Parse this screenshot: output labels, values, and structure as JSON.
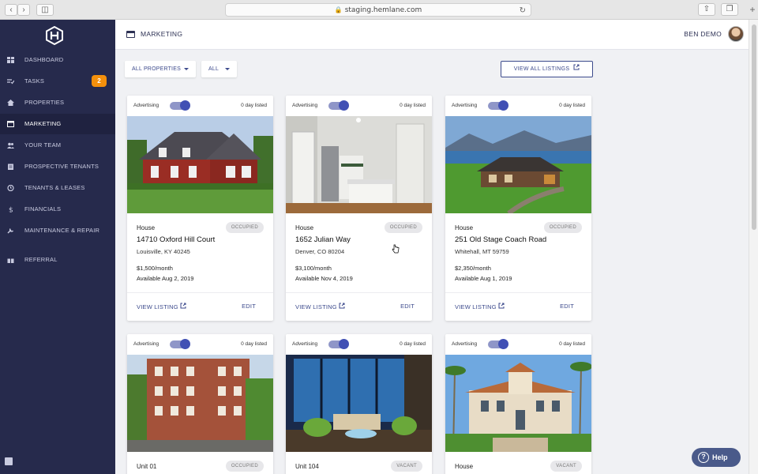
{
  "browser": {
    "url": "staging.hemlane.com"
  },
  "sidebar": {
    "items": [
      {
        "label": "DASHBOARD",
        "icon": "dashboard-icon"
      },
      {
        "label": "TASKS",
        "icon": "tasks-icon",
        "badge": "2"
      },
      {
        "label": "PROPERTIES",
        "icon": "home-icon"
      },
      {
        "label": "MARKETING",
        "icon": "marketing-icon"
      },
      {
        "label": "YOUR TEAM",
        "icon": "team-icon"
      },
      {
        "label": "PROSPECTIVE TENANTS",
        "icon": "clipboard-icon"
      },
      {
        "label": "TENANTS & LEASES",
        "icon": "clock-icon"
      },
      {
        "label": "FINANCIALS",
        "icon": "dollar-icon"
      },
      {
        "label": "MAINTENANCE & REPAIR",
        "icon": "wrench-icon"
      },
      {
        "label": "REFERRAL",
        "icon": "gift-icon"
      }
    ]
  },
  "header": {
    "title": "MARKETING",
    "user": "BEN DEMO"
  },
  "filters": {
    "properties": "ALL PROPERTIES",
    "status": "ALL",
    "view_all": "VIEW ALL LISTINGS"
  },
  "cards": [
    {
      "advertising": "Advertising",
      "days": "0 day listed",
      "type": "House",
      "status": "OCCUPIED",
      "address": "14710 Oxford Hill Court",
      "city": "Louisville, KY 40245",
      "price": "$1,500/month",
      "available": "Available Aug 2, 2019",
      "view": "VIEW LISTING",
      "edit": "EDIT"
    },
    {
      "advertising": "Advertising",
      "days": "0 day listed",
      "type": "House",
      "status": "OCCUPIED",
      "address": "1652 Julian Way",
      "city": "Denver, CO 80204",
      "price": "$3,100/month",
      "available": "Available Nov 4, 2019",
      "view": "VIEW LISTING",
      "edit": "EDIT"
    },
    {
      "advertising": "Advertising",
      "days": "0 day listed",
      "type": "House",
      "status": "OCCUPIED",
      "address": "251 Old Stage Coach Road",
      "city": "Whitehall, MT 59759",
      "price": "$2,350/month",
      "available": "Available Aug 1, 2019",
      "view": "VIEW LISTING",
      "edit": "EDIT"
    },
    {
      "advertising": "Advertising",
      "days": "0 day listed",
      "type": "Unit 01",
      "status": "OCCUPIED"
    },
    {
      "advertising": "Advertising",
      "days": "0 day listed",
      "type": "Unit 104",
      "status": "VACANT"
    },
    {
      "advertising": "Advertising",
      "days": "0 day listed",
      "type": "House",
      "status": "VACANT"
    }
  ],
  "help": {
    "label": "Help"
  },
  "colors": {
    "sidebar": "#262a4c",
    "accent": "#3c4a8c",
    "toggle": "#4150b4",
    "badge": "#f4900c"
  }
}
